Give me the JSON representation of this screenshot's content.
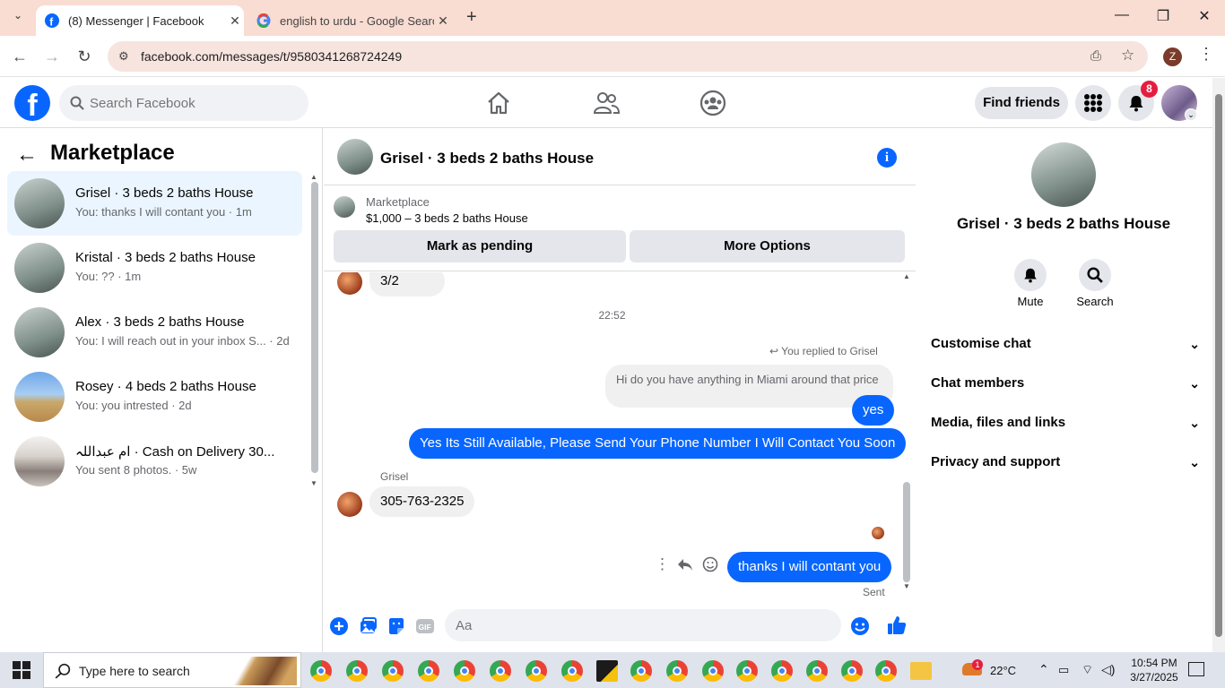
{
  "browser": {
    "tabs": [
      {
        "title": "(8) Messenger | Facebook",
        "active": true,
        "icon": "facebook-icon"
      },
      {
        "title": "english to urdu - Google Search",
        "active": false,
        "icon": "google-icon"
      }
    ],
    "url": "facebook.com/messages/t/9580341268724249",
    "profile_letter": "Z"
  },
  "fb_header": {
    "search_placeholder": "Search Facebook",
    "find_friends": "Find friends",
    "notification_count": "8",
    "brand_color": "#0866ff"
  },
  "left_panel": {
    "title": "Marketplace",
    "conversations": [
      {
        "name": "Grisel · 3 beds 2 baths House",
        "preview": "You: thanks I will contant you · 1m",
        "selected": true
      },
      {
        "name": "Kristal · 3 beds 2 baths House",
        "preview": "You: ?? · 1m",
        "selected": false
      },
      {
        "name": "Alex · 3 beds 2 baths House",
        "preview": "You: I will reach out in your inbox S... · 2d",
        "selected": false
      },
      {
        "name": "Rosey · 4 beds 2 baths House",
        "preview": "You: you intrested · 2d",
        "selected": false
      },
      {
        "name": "ام عبداللہ · Cash on Delivery 30...",
        "preview": "You sent 8 photos. · 5w",
        "selected": false
      }
    ]
  },
  "chat": {
    "title": "Grisel · 3 beds 2 baths House",
    "marketplace_label": "Marketplace",
    "listing": "$1,000 – 3 beds 2 baths House",
    "mark_pending": "Mark as pending",
    "more_options": "More Options",
    "messages": {
      "first_in": "3/2",
      "time_divider": "22:52",
      "reply_note": "You replied to Grisel",
      "quoted": "Hi do you have anything in Miami around that price",
      "out_yes": "yes",
      "out_long": "Yes Its Still Available, Please Send Your Phone Number I Will Contact You Soon",
      "sender_name": "Grisel",
      "in_phone": "305-763-2325",
      "out_last": "thanks I will contant you",
      "status": "Sent"
    },
    "input_placeholder": "Aa"
  },
  "right_panel": {
    "name": "Grisel · 3 beds 2 baths House",
    "mute": "Mute",
    "search": "Search",
    "sections": [
      "Customise chat",
      "Chat members",
      "Media, files and links",
      "Privacy and support"
    ]
  },
  "taskbar": {
    "search_placeholder": "Type here to search",
    "weather_badge": "1",
    "temperature": "22°C",
    "time": "10:54 PM",
    "date": "3/27/2025"
  }
}
